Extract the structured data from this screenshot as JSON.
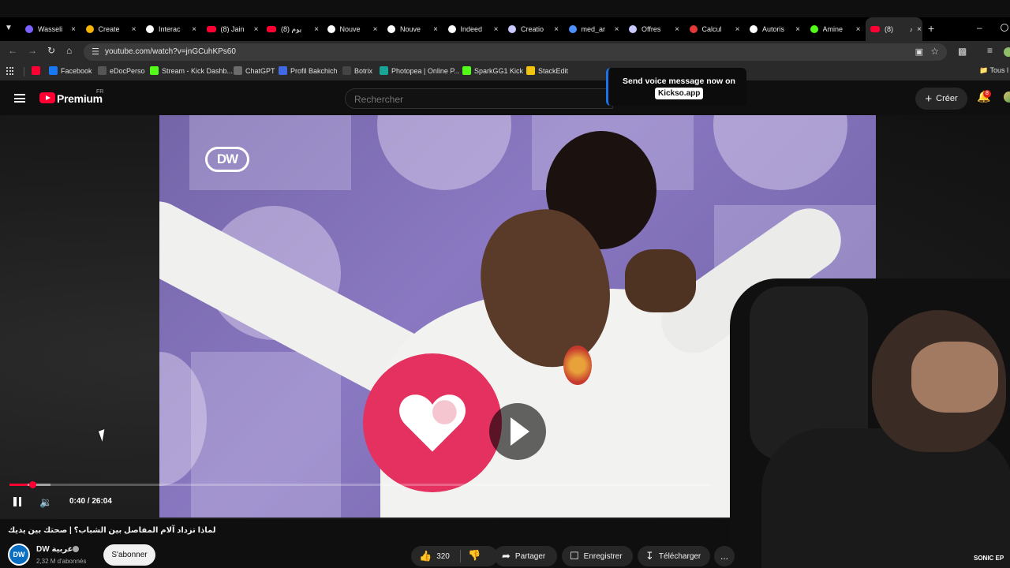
{
  "browser": {
    "tabs": [
      {
        "label": "Wasseli",
        "icon": "wassel-icon",
        "color": "#7b61ff"
      },
      {
        "label": "Create",
        "icon": "create-icon",
        "color": "#f4b400"
      },
      {
        "label": "Interac",
        "icon": "interac-icon",
        "color": "#ffffff"
      },
      {
        "label": "(8) Jain",
        "icon": "youtube-icon",
        "color": "#ff0033"
      },
      {
        "label": "(8) يوم",
        "icon": "youtube-icon",
        "color": "#ff0033"
      },
      {
        "label": "Nouve",
        "icon": "info-icon",
        "color": "#ffffff"
      },
      {
        "label": "Nouve",
        "icon": "info-icon",
        "color": "#ffffff"
      },
      {
        "label": "Indeed",
        "icon": "info-icon",
        "color": "#ffffff"
      },
      {
        "label": "Creatio",
        "icon": "ai-icon",
        "color": "#c9c9ff"
      },
      {
        "label": "med_ar",
        "icon": "med-icon",
        "color": "#4d90fe"
      },
      {
        "label": "Offres",
        "icon": "ai-icon",
        "color": "#c9c9ff"
      },
      {
        "label": "Calcul",
        "icon": "calc-icon",
        "color": "#e53935"
      },
      {
        "label": "Autoris",
        "icon": "autoris-icon",
        "color": "#ffffff"
      },
      {
        "label": "Amine",
        "icon": "kick-icon",
        "color": "#53fc18"
      },
      {
        "label": "(8)",
        "icon": "youtube-icon",
        "color": "#ff0033",
        "active": true
      }
    ],
    "url": "youtube.com/watch?v=jnGCuhKPs60",
    "bookmarks": [
      {
        "label": "",
        "icon": "youtube-icon",
        "color": "#ff0033"
      },
      {
        "label": "Facebook",
        "icon": "facebook-icon",
        "color": "#1877f2"
      },
      {
        "label": "eDocPerso",
        "icon": "edocperso-icon",
        "color": "#555555"
      },
      {
        "label": "Stream - Kick Dashb...",
        "icon": "kick-icon",
        "color": "#53fc18"
      },
      {
        "label": "ChatGPT",
        "icon": "chatgpt-icon",
        "color": "#6b6b6b"
      },
      {
        "label": "Profil Bakchich",
        "icon": "bakchich-icon",
        "color": "#4169e1"
      },
      {
        "label": "Botrix",
        "icon": "botrix-icon",
        "color": "#444444"
      },
      {
        "label": "Photopea | Online P...",
        "icon": "photopea-icon",
        "color": "#18a497"
      },
      {
        "label": "SparkGG1 Kick",
        "icon": "kick-icon",
        "color": "#53fc18"
      },
      {
        "label": "StackEdit",
        "icon": "stackedit-icon",
        "color": "#f1c40f"
      }
    ],
    "all_bookmarks": "Tous l"
  },
  "youtube": {
    "brand": "Premium",
    "region": "FR",
    "search_placeholder": "Rechercher",
    "create_label": "Créer",
    "notification_count": "8"
  },
  "popup": {
    "text": "Send voice message now on",
    "pill": "Kickso.app"
  },
  "video": {
    "overlay_logo": "DW",
    "time": "0:40 / 26:04",
    "progress_fraction": 0.026,
    "buffer_fraction": 0.058,
    "title": "لماذا تزداد آلام المفاصل بين الشباب؟ | صحتك بين يديك",
    "channel_name": "DW عربية",
    "channel_avatar": "DW",
    "subscribers": "2,32 M d'abonnés",
    "subscribe_label": "S'abonner",
    "likes": "320",
    "share_label": "Partager",
    "save_label": "Enregistrer",
    "download_label": "Télécharger",
    "more_label": "...",
    "webcam_caption": "SONIC EP"
  },
  "colors": {
    "accent": "#ff0033",
    "heart": "#e4315f",
    "popup_border": "#1a73e8",
    "video_bg": "#8a79c2"
  }
}
